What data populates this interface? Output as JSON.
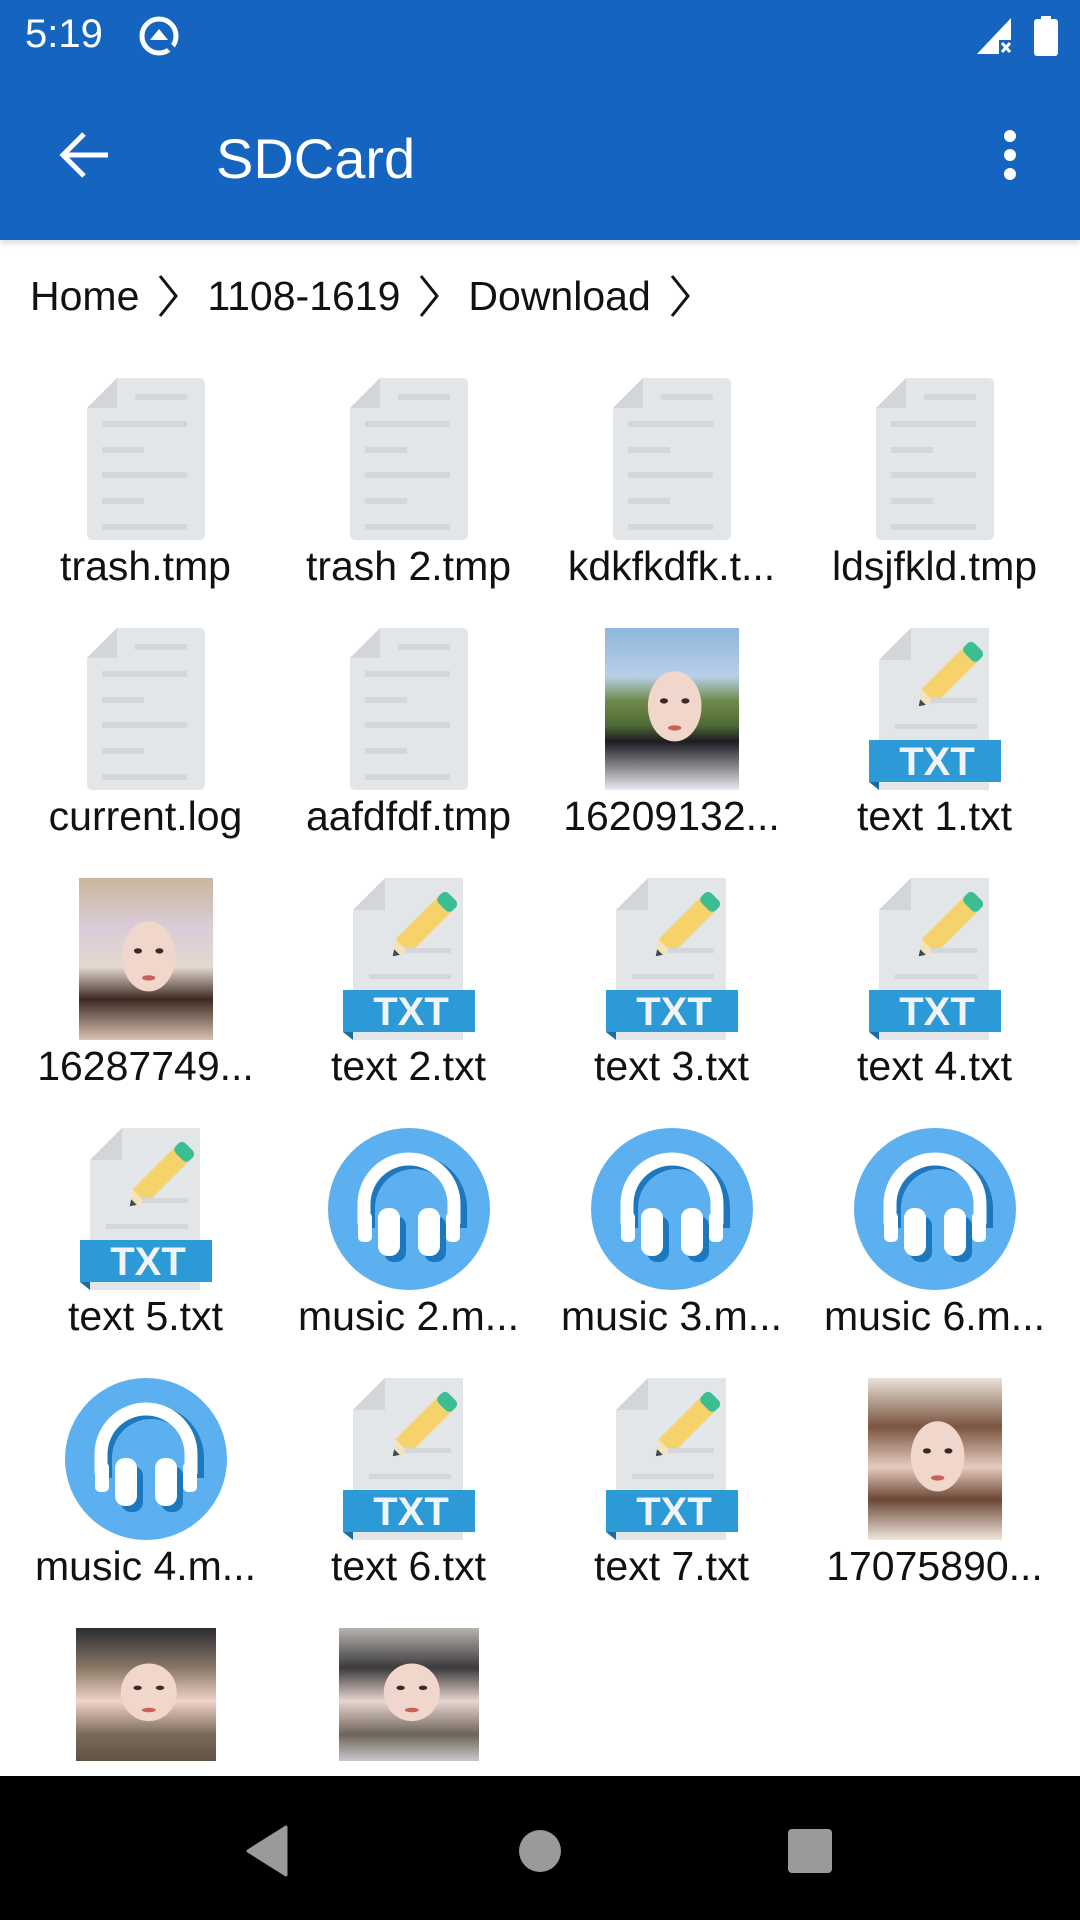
{
  "status_bar": {
    "time": "5:19",
    "icons": [
      "q-logo-icon",
      "signal-no-service-icon",
      "battery-full-icon"
    ]
  },
  "toolbar": {
    "title": "SDCard",
    "back_icon": "arrow-left-icon",
    "menu_icon": "more-vert-icon"
  },
  "breadcrumb": [
    {
      "label": "Home"
    },
    {
      "label": "1108-1619"
    },
    {
      "label": "Download"
    }
  ],
  "files": [
    {
      "name": "trash.tmp",
      "type": "generic"
    },
    {
      "name": "trash 2.tmp",
      "type": "generic"
    },
    {
      "name": "kdkfkdfk.t...",
      "type": "generic"
    },
    {
      "name": "ldsjfkld.tmp",
      "type": "generic"
    },
    {
      "name": "current.log",
      "type": "generic"
    },
    {
      "name": "aafdfdf.tmp",
      "type": "generic"
    },
    {
      "name": "16209132...",
      "type": "image"
    },
    {
      "name": "text 1.txt",
      "type": "txt"
    },
    {
      "name": "16287749...",
      "type": "image"
    },
    {
      "name": "text 2.txt",
      "type": "txt"
    },
    {
      "name": "text 3.txt",
      "type": "txt"
    },
    {
      "name": "text 4.txt",
      "type": "txt"
    },
    {
      "name": "text 5.txt",
      "type": "txt"
    },
    {
      "name": "music 2.m...",
      "type": "music"
    },
    {
      "name": "music 3.m...",
      "type": "music"
    },
    {
      "name": "music 6.m...",
      "type": "music"
    },
    {
      "name": "music 4.m...",
      "type": "music"
    },
    {
      "name": "text 6.txt",
      "type": "txt"
    },
    {
      "name": "text 7.txt",
      "type": "txt"
    },
    {
      "name": "17075890...",
      "type": "image"
    },
    {
      "name": "",
      "type": "image"
    },
    {
      "name": "",
      "type": "image"
    }
  ],
  "txt_badge": "TXT",
  "colors": {
    "primary": "#1565C0",
    "music_circle": "#5DB0F0",
    "music_shadow": "#1B78BE",
    "txt_band": "#2C9AD6",
    "doc_gray": "#E3E6E9"
  },
  "nav_bar": {
    "back": "nav-back-icon",
    "home": "nav-home-icon",
    "recents": "nav-recents-icon"
  }
}
